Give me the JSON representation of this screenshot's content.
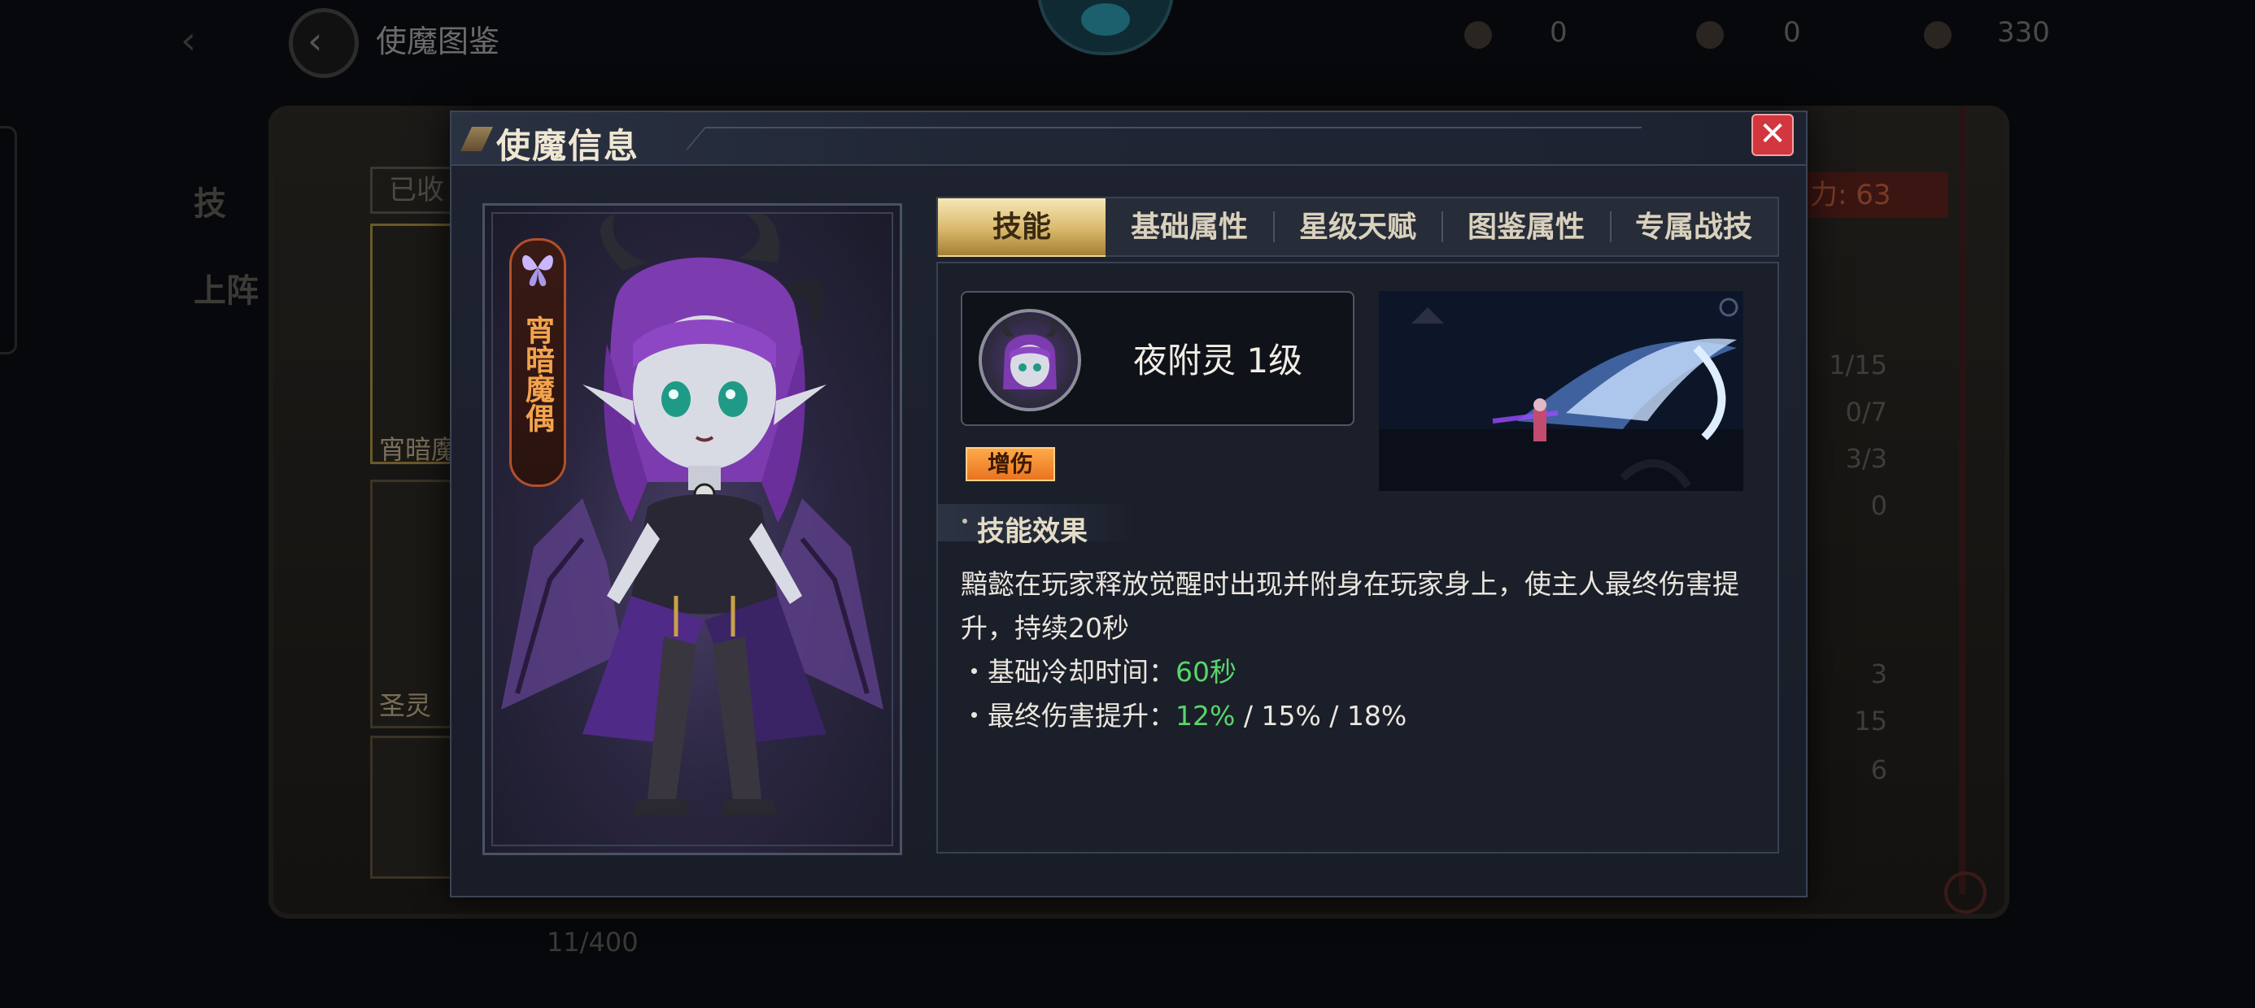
{
  "background": {
    "page_title": "使魔图鉴",
    "resources": [
      "0",
      "0",
      "330"
    ],
    "collected_tab": "已收",
    "power_label": "力: 63",
    "stats": [
      "1/15",
      "0/7",
      "3/3",
      "0",
      "3",
      "15",
      "6"
    ],
    "cards": [
      "宵暗魔",
      "圣灵"
    ],
    "bottom_counter": "11/400",
    "left_labels": [
      "技",
      "上阵"
    ]
  },
  "modal": {
    "title": "使魔信息",
    "close_label": "✕",
    "character": {
      "name": "宵暗魔偶"
    },
    "tabs": [
      {
        "label": "技能",
        "active": true
      },
      {
        "label": "基础属性",
        "active": false
      },
      {
        "label": "星级天赋",
        "active": false
      },
      {
        "label": "图鉴属性",
        "active": false
      },
      {
        "label": "专属战技",
        "active": false
      }
    ],
    "skill": {
      "name": "夜附灵 1级",
      "tag": "增伤",
      "section_title": "技能效果",
      "description": "黯懿在玩家释放觉醒时出现并附身在玩家身上，使主人最终伤害提升，持续20秒",
      "cooldown_label": "・基础冷却时间：",
      "cooldown_value": "60秒",
      "damage_label": "・最终伤害提升：",
      "damage_value": "12%",
      "damage_rest": " / 15% / 18%"
    }
  },
  "colors": {
    "accent_gold": "#d9b86a",
    "close_red": "#d2363f",
    "tag_orange": "#ffa94a",
    "value_green": "#58d66a",
    "name_orange": "#f2a34c"
  }
}
